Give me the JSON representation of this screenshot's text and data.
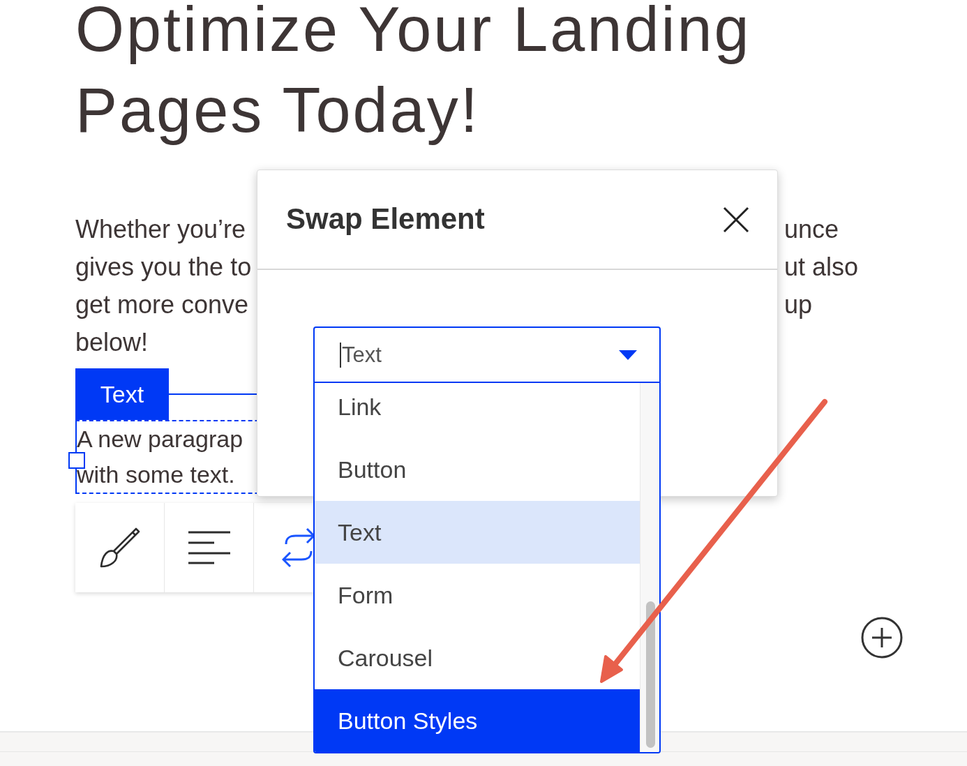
{
  "heading": "Optimize Your Landing Pages Today!",
  "intro_left": [
    "Whether you’re",
    "gives you the to",
    "get more conve",
    "below!"
  ],
  "intro_right": [
    "unce",
    "ut also",
    "up"
  ],
  "element_tag": "Text",
  "paragraph_lines": [
    "A new paragrap",
    "with some text."
  ],
  "toolbar": [
    {
      "kind": "brush",
      "selected": false
    },
    {
      "kind": "align",
      "selected": false
    },
    {
      "kind": "swap",
      "selected": true
    }
  ],
  "dialog": {
    "title": "Swap Element",
    "select": {
      "value": "Text"
    },
    "options": [
      {
        "label": "Link",
        "selected": false,
        "highlighted": false
      },
      {
        "label": "Button",
        "selected": false,
        "highlighted": false
      },
      {
        "label": "Text",
        "selected": true,
        "highlighted": false
      },
      {
        "label": "Form",
        "selected": false,
        "highlighted": false
      },
      {
        "label": "Carousel",
        "selected": false,
        "highlighted": false
      },
      {
        "label": "Button Styles",
        "selected": false,
        "highlighted": true
      }
    ]
  }
}
